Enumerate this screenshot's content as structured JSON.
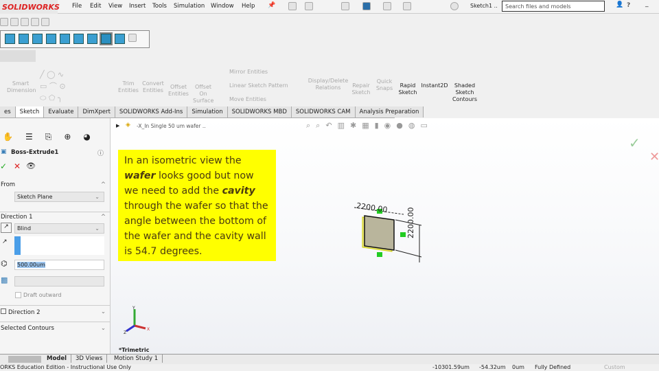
{
  "app": {
    "logo": "SOLIDWORKS",
    "doc_title": "Sketch1 ..",
    "search_placeholder": "Search files and models"
  },
  "menu": [
    "File",
    "Edit",
    "View",
    "Insert",
    "Tools",
    "Simulation",
    "Window",
    "Help"
  ],
  "commands": {
    "smart_dimension": "Smart Dimension",
    "trim": "Trim Entities",
    "convert": "Convert Entities",
    "offset": "Offset Entities",
    "offset_surface": "Offset On Surface",
    "mirror": "Mirror Entities",
    "linear_pattern": "Linear Sketch Pattern",
    "move": "Move Entities",
    "display_delete": "Display/Delete Relations",
    "repair": "Repair Sketch",
    "quick_snaps": "Quick Snaps",
    "rapid_sketch": "Rapid Sketch",
    "instant2d": "Instant2D",
    "shaded": "Shaded Sketch Contours"
  },
  "tabs": [
    "es",
    "Sketch",
    "Evaluate",
    "DimXpert",
    "SOLIDWORKS Add-Ins",
    "Simulation",
    "SOLIDWORKS MBD",
    "SOLIDWORKS CAM",
    "Analysis Preparation"
  ],
  "feature": {
    "title": "Boss-Extrude1",
    "from_label": "From",
    "from_value": "Sketch Plane",
    "dir1_label": "Direction 1",
    "dir1_type": "Blind",
    "depth": "500.00um",
    "draft_label": "Draft outward",
    "dir2_label": "Direction 2",
    "contours_label": "Selected Contours"
  },
  "tree": {
    "part": "-X_In Single 50 um wafer .."
  },
  "note": {
    "p1": "In an isometric view the ",
    "wafer": "wafer",
    "p2": " looks good but now we need to add the ",
    "cavity": "cavity",
    "p3": " through the wafer so that the angle between the bottom of the wafer and the cavity wall is 54.7 degrees."
  },
  "model": {
    "dim_h": "2200.00",
    "dim_v": "2200.00"
  },
  "view": {
    "orientation": "*Trimetric",
    "axis_x": "X",
    "axis_y": "Y",
    "axis_z": "Z"
  },
  "bottom_tabs": [
    "Model",
    "3D Views",
    "Motion Study 1"
  ],
  "status": {
    "edition": "ORKS Education Edition - Instructional Use Only",
    "x": "-10301.59um",
    "y": "-54.32um",
    "z": "0um",
    "state": "Fully Defined",
    "units": "Custom"
  }
}
